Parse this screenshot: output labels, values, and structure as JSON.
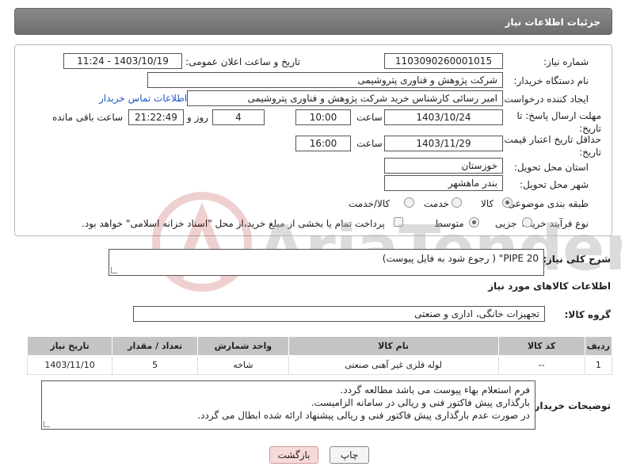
{
  "header": {
    "title": "جزئیات اطلاعات نیاز"
  },
  "fields": {
    "need_number_label": "شماره نیاز:",
    "need_number": "1103090260001015",
    "announce_label": "تاریخ و ساعت اعلان عمومی:",
    "announce_value": "1403/10/19 - 11:24",
    "buyer_label": "نام دستگاه خریدار:",
    "buyer_value": "شرکت پژوهش و فناوری پتروشیمی",
    "creator_label": "ایجاد کننده درخواست:",
    "creator_value": "امیر رسائی کارشناس خرید شرکت پژوهش و فناوری پتروشیمی",
    "contact_link": "اطلاعات تماس خریدار",
    "deadline_label": "مهلت ارسال پاسخ: تا تاریخ:",
    "deadline_date": "1403/10/24",
    "time_label": "ساعت",
    "deadline_time": "10:00",
    "days_value": "4",
    "days_label": "روز و",
    "remaining_value": "21:22:49",
    "remaining_label": "ساعت باقی مانده",
    "validity_label": "حداقل تاریخ اعتبار قیمت: تا تاریخ:",
    "validity_date": "1403/11/29",
    "validity_time_label": "ساعت",
    "validity_time": "16:00",
    "province_label": "استان محل تحویل:",
    "province_value": "خوزستان",
    "city_label": "شهر محل تحویل:",
    "city_value": "بندر ماهشهر",
    "category_label": "طبقه بندی موضوعی:",
    "category_options": [
      "کالا",
      "خدمت",
      "کالا/خدمت"
    ],
    "process_label": "نوع فرآیند خرید :",
    "process_options": [
      "جزیی",
      "متوسط"
    ],
    "payment_note": "پرداخت تمام یا بخشی از مبلغ خرید،از محل \"اسناد خزانه اسلامی\" خواهد بود."
  },
  "description": {
    "label": "شرح کلی نیاز:",
    "value": "PIPE 20\" ( رجوع شود به فایل پیوست)"
  },
  "goods_section": {
    "title": "اطلاعات کالاهای مورد نیاز",
    "group_label": "گروه کالا:",
    "group_value": "تجهیزات خانگی، اداری و صنعتی"
  },
  "table": {
    "headers": [
      "ردیف",
      "کد کالا",
      "نام کالا",
      "واحد شمارش",
      "تعداد / مقدار",
      "تاریخ نیاز"
    ],
    "rows": [
      [
        "1",
        "--",
        "لوله فلزی غیر آهنی صنعتی",
        "شاخه",
        "5",
        "1403/11/10"
      ]
    ]
  },
  "buyer_notes": {
    "label": "توضیحات خریدار:",
    "lines": [
      "فرم استعلام بهاء پیوست می باشد مطالعه گردد.",
      "بارگذاری پیش فاکتور فنی و ریالی در سامانه الزامیست.",
      "در صورت عدم بارگذاری پیش فاکتور فنی و ریالی پیشنهاد ارائه شده ابطال می گردد."
    ]
  },
  "buttons": {
    "print": "چاپ",
    "back": "بازگشت"
  },
  "watermark": {
    "text": "AriaTender.net"
  },
  "colors": {
    "header_bg": "#7a7a7a",
    "link": "#1f57c8",
    "back_btn_bg": "#f8d9d9"
  }
}
